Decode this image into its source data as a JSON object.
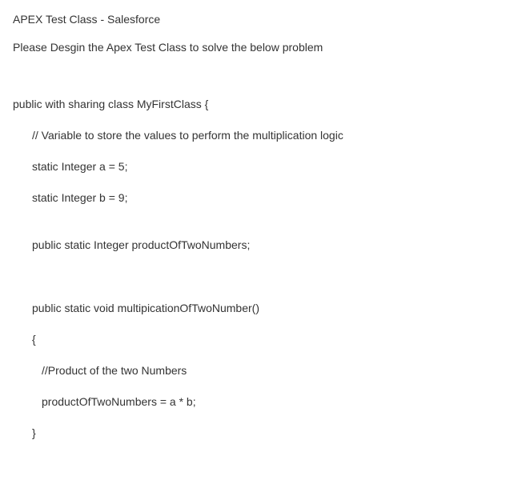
{
  "title": "APEX Test Class - Salesforce",
  "subtitle": "Please Desgin the Apex Test Class to solve the below problem",
  "code": {
    "line1": "public with sharing class MyFirstClass {",
    "line2": "// Variable to store the values to perform the multiplication logic",
    "line3": "static Integer a = 5;",
    "line4": "static Integer b = 9;",
    "line5": "public static Integer productOfTwoNumbers;",
    "line6": "public static void multipicationOfTwoNumber()",
    "line7": "{",
    "line8": "//Product of the two Numbers",
    "line9": "productOfTwoNumbers = a * b;",
    "line10": "}"
  }
}
